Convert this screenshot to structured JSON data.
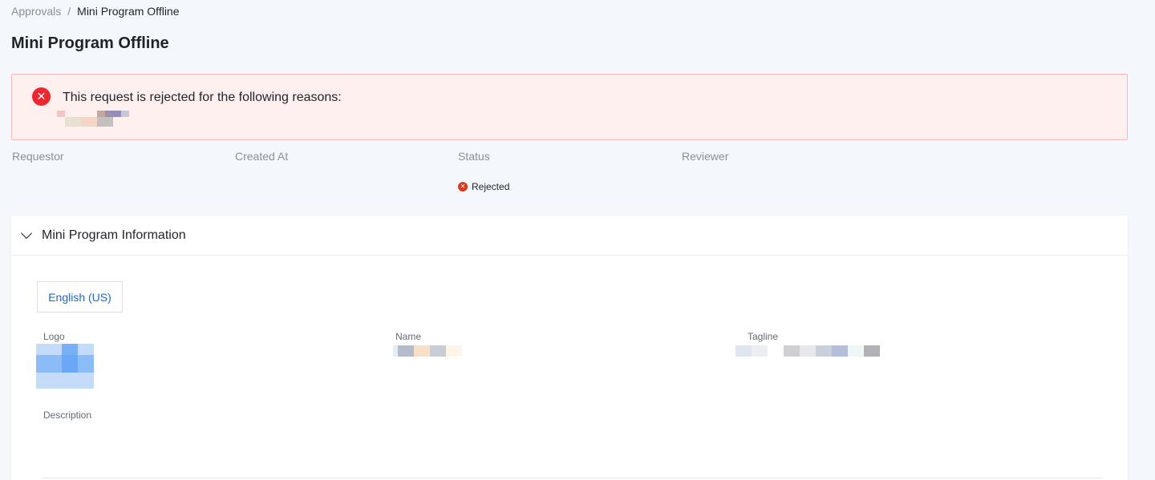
{
  "breadcrumb": {
    "parent": "Approvals",
    "separator": "/",
    "current": "Mini Program Offline"
  },
  "page_title": "Mini Program Offline",
  "alert": {
    "message": "This request is rejected for the following reasons:",
    "icon": "close-circle-icon",
    "color": "#f0262f"
  },
  "meta": {
    "requestor_label": "Requestor",
    "created_at_label": "Created At",
    "status_label": "Status",
    "reviewer_label": "Reviewer",
    "status_value": "Rejected",
    "status_icon": "close-circle-icon",
    "status_color": "#d93a1b"
  },
  "section": {
    "title": "Mini Program Information",
    "icon": "chevron-down-icon",
    "language_tab": "English (US)",
    "logo_label": "Logo",
    "name_label": "Name",
    "tagline_label": "Tagline",
    "description_label": "Description"
  },
  "colors": {
    "background": "#f4f7fc",
    "accent": "#1a66d9",
    "alert_bg": "#fff0f0",
    "alert_border": "#f6b8b8"
  }
}
